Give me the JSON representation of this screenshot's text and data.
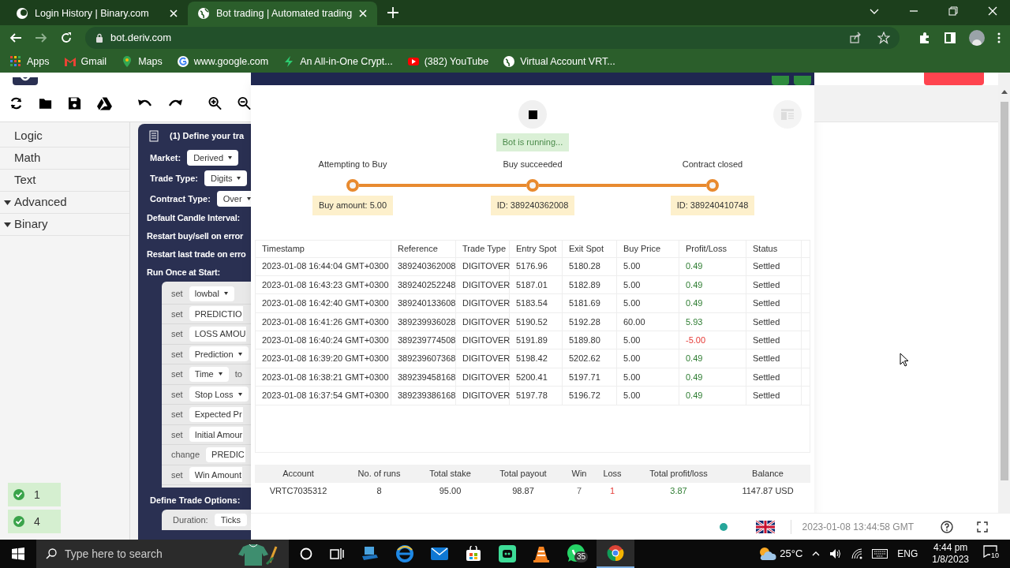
{
  "browser": {
    "tabs": [
      {
        "title": "Login History | Binary.com",
        "selected": false
      },
      {
        "title": "Bot trading | Automated trading",
        "selected": true
      }
    ],
    "url": "bot.deriv.com",
    "bookmarks": [
      "Apps",
      "Gmail",
      "Maps",
      "www.google.com",
      "An All-in-One Crypt...",
      "(382) YouTube",
      "Virtual Account VRT..."
    ]
  },
  "sidebar": {
    "items": [
      {
        "label": "Logic",
        "expandable": false
      },
      {
        "label": "Math",
        "expandable": false
      },
      {
        "label": "Text",
        "expandable": false
      },
      {
        "label": "Advanced",
        "expandable": true
      },
      {
        "label": "Binary",
        "expandable": true
      }
    ]
  },
  "block": {
    "title": "(1) Define your tra",
    "fields": [
      {
        "label": "Market:",
        "value": "Derived"
      },
      {
        "label": "Trade Type:",
        "value": "Digits"
      },
      {
        "label": "Contract Type:",
        "value": "Over"
      }
    ],
    "options": [
      "Default Candle Interval:",
      "Restart buy/sell on error",
      "Restart last trade on erro",
      "Run Once at Start:"
    ],
    "statements": [
      {
        "verb": "set",
        "variable": "lowbal",
        "dropdown": true
      },
      {
        "verb": "set",
        "variable": "PREDICTIO",
        "dropdown": false
      },
      {
        "verb": "set",
        "variable": "LOSS AMOU",
        "dropdown": false
      },
      {
        "verb": "set",
        "variable": "Prediction",
        "dropdown": true
      },
      {
        "verb": "set",
        "variable": "Time",
        "dropdown": true,
        "suffix": "to"
      },
      {
        "verb": "set",
        "variable": "Stop Loss",
        "dropdown": true
      },
      {
        "verb": "set",
        "variable": "Expected Pr",
        "dropdown": false
      },
      {
        "verb": "set",
        "variable": "Initial Amour",
        "dropdown": false
      },
      {
        "verb": "change",
        "variable": "PREDIC",
        "dropdown": false
      },
      {
        "verb": "set",
        "variable": "Win Amount",
        "dropdown": false
      }
    ],
    "trade_options": "Define Trade Options:",
    "duration": {
      "label": "Duration:",
      "value": "Ticks"
    }
  },
  "counters": [
    "1",
    "4"
  ],
  "summary": {
    "status": "Bot is running...",
    "steps": [
      {
        "label": "Attempting to Buy",
        "tag": "Buy amount: 5.00"
      },
      {
        "label": "Buy succeeded",
        "tag": "ID: 389240362008"
      },
      {
        "label": "Contract closed",
        "tag": "ID: 389240410748"
      }
    ],
    "table": {
      "columns": [
        "Timestamp",
        "Reference",
        "Trade Type",
        "Entry Spot",
        "Exit Spot",
        "Buy Price",
        "Profit/Loss",
        "Status"
      ],
      "rows": [
        {
          "cells": [
            "2023-01-08 16:44:04 GMT+0300",
            "389240362008",
            "DIGITOVER",
            "5176.96",
            "5180.28",
            "5.00",
            "0.49",
            "Settled"
          ],
          "loss": false
        },
        {
          "cells": [
            "2023-01-08 16:43:23 GMT+0300",
            "389240252248",
            "DIGITOVER",
            "5187.01",
            "5182.89",
            "5.00",
            "0.49",
            "Settled"
          ],
          "loss": false
        },
        {
          "cells": [
            "2023-01-08 16:42:40 GMT+0300",
            "389240133608",
            "DIGITOVER",
            "5183.54",
            "5181.69",
            "5.00",
            "0.49",
            "Settled"
          ],
          "loss": false
        },
        {
          "cells": [
            "2023-01-08 16:41:26 GMT+0300",
            "389239936028",
            "DIGITOVER",
            "5190.52",
            "5192.28",
            "60.00",
            "5.93",
            "Settled"
          ],
          "loss": false
        },
        {
          "cells": [
            "2023-01-08 16:40:24 GMT+0300",
            "389239774508",
            "DIGITOVER",
            "5191.89",
            "5189.80",
            "5.00",
            "-5.00",
            "Settled"
          ],
          "loss": true
        },
        {
          "cells": [
            "2023-01-08 16:39:20 GMT+0300",
            "389239607368",
            "DIGITOVER",
            "5198.42",
            "5202.62",
            "5.00",
            "0.49",
            "Settled"
          ],
          "loss": false
        },
        {
          "cells": [
            "2023-01-08 16:38:21 GMT+0300",
            "389239458168",
            "DIGITOVER",
            "5200.41",
            "5197.71",
            "5.00",
            "0.49",
            "Settled"
          ],
          "loss": false
        },
        {
          "cells": [
            "2023-01-08 16:37:54 GMT+0300",
            "389239386168",
            "DIGITOVER",
            "5197.78",
            "5196.72",
            "5.00",
            "0.49",
            "Settled"
          ],
          "loss": false
        }
      ]
    },
    "totals": [
      {
        "label": "Account",
        "value": "VRTC7035312",
        "kind": "plain"
      },
      {
        "label": "No. of runs",
        "value": "8",
        "kind": "plain"
      },
      {
        "label": "Total stake",
        "value": "95.00",
        "kind": "plain"
      },
      {
        "label": "Total payout",
        "value": "98.87",
        "kind": "plain"
      },
      {
        "label": "Win",
        "value": "7",
        "kind": "muted"
      },
      {
        "label": "Loss",
        "value": "1",
        "kind": "loss"
      },
      {
        "label": "Total profit/loss",
        "value": "3.87",
        "kind": "profit"
      },
      {
        "label": "Balance",
        "value": "1147.87 USD",
        "kind": "plain"
      }
    ]
  },
  "footer": {
    "server_time": "2023-01-08 13:44:58 GMT"
  },
  "taskbar": {
    "search_placeholder": "Type here to search",
    "whatsapp_badge": "35",
    "temperature": "25°C",
    "language": "ENG",
    "time": "4:44 pm",
    "date": "1/8/2023",
    "notifications": "10"
  }
}
